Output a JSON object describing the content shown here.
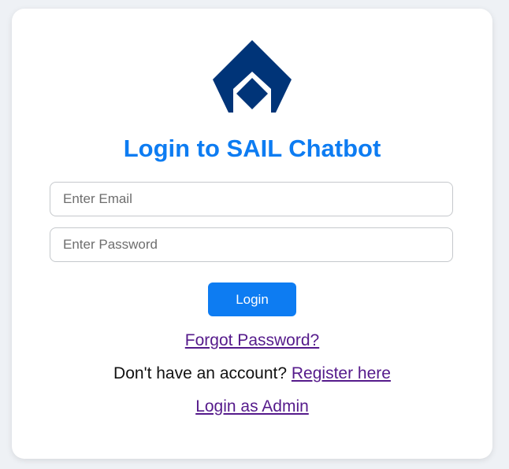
{
  "brand": {
    "logo_icon": "sail-logo-icon",
    "logo_color": "#003478"
  },
  "login": {
    "title": "Login to SAIL Chatbot",
    "email_placeholder": "Enter Email",
    "email_value": "",
    "password_placeholder": "Enter Password",
    "password_value": "",
    "login_button_label": "Login",
    "forgot_password_link": "Forgot Password?",
    "no_account_text": "Don't have an account?",
    "register_link": "Register here",
    "admin_login_link": "Login as Admin"
  },
  "colors": {
    "accent": "#0d7cf2",
    "link": "#551a8b",
    "page_background": "#eef1f5",
    "card_background": "#ffffff"
  }
}
